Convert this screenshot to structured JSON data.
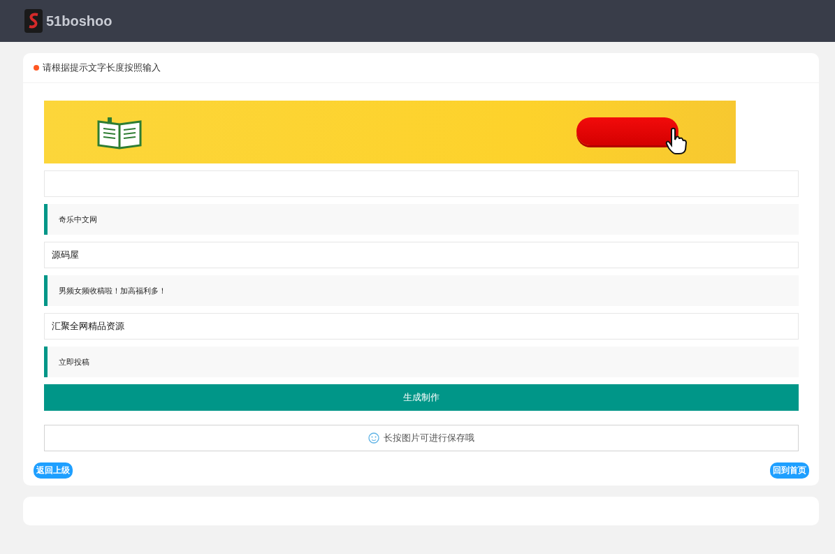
{
  "header": {
    "logo_text": "51boshoo"
  },
  "card": {
    "title": "请根据提示文字长度按照输入",
    "items": [
      {
        "kind": "field"
      },
      {
        "kind": "quote",
        "text": "奇乐中文网"
      },
      {
        "kind": "field",
        "value": "源码屋"
      },
      {
        "kind": "quote",
        "text": "男频女频收稿啦！加高福利多！"
      },
      {
        "kind": "field",
        "value": "汇聚全网精品资源"
      },
      {
        "kind": "quote",
        "text": "立即投稿"
      }
    ],
    "generate_button": "生成制作",
    "tip": "长按图片可进行保存哦",
    "back_link": "返回上级",
    "home_link": "回到首页"
  }
}
